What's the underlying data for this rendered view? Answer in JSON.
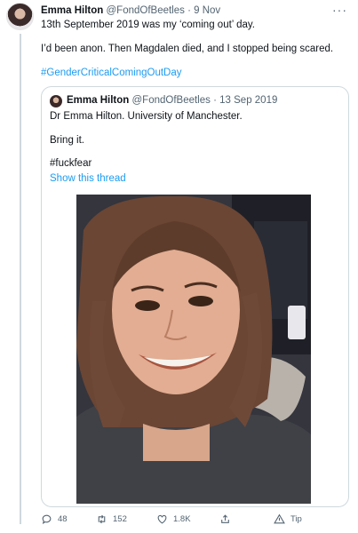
{
  "tweet": {
    "author_name": "Emma Hilton",
    "author_handle": "@FondOfBeetles",
    "date_separator": "·",
    "date": "9 Nov",
    "more_label": "···",
    "line1": "13th September 2019 was my ‘coming out’ day.",
    "line2": "I’d been anon. Then Magdalen died, and I stopped being scared.",
    "hashtag": "#GenderCriticalComingOutDay"
  },
  "quoted": {
    "author_name": "Emma Hilton",
    "author_handle": "@FondOfBeetles",
    "date_separator": "·",
    "date": "13 Sep 2019",
    "line1": "Dr Emma Hilton. University of Manchester.",
    "line2": "Bring it.",
    "hashtag": "#fuckfear",
    "show_thread": "Show this thread"
  },
  "actions": {
    "reply_count": "48",
    "retweet_count": "152",
    "like_count": "1.8K",
    "tip_label": "Tip"
  },
  "colors": {
    "accent": "#1d9bf0",
    "text": "#0f1419",
    "muted": "#536471",
    "border": "#cfd9de"
  }
}
